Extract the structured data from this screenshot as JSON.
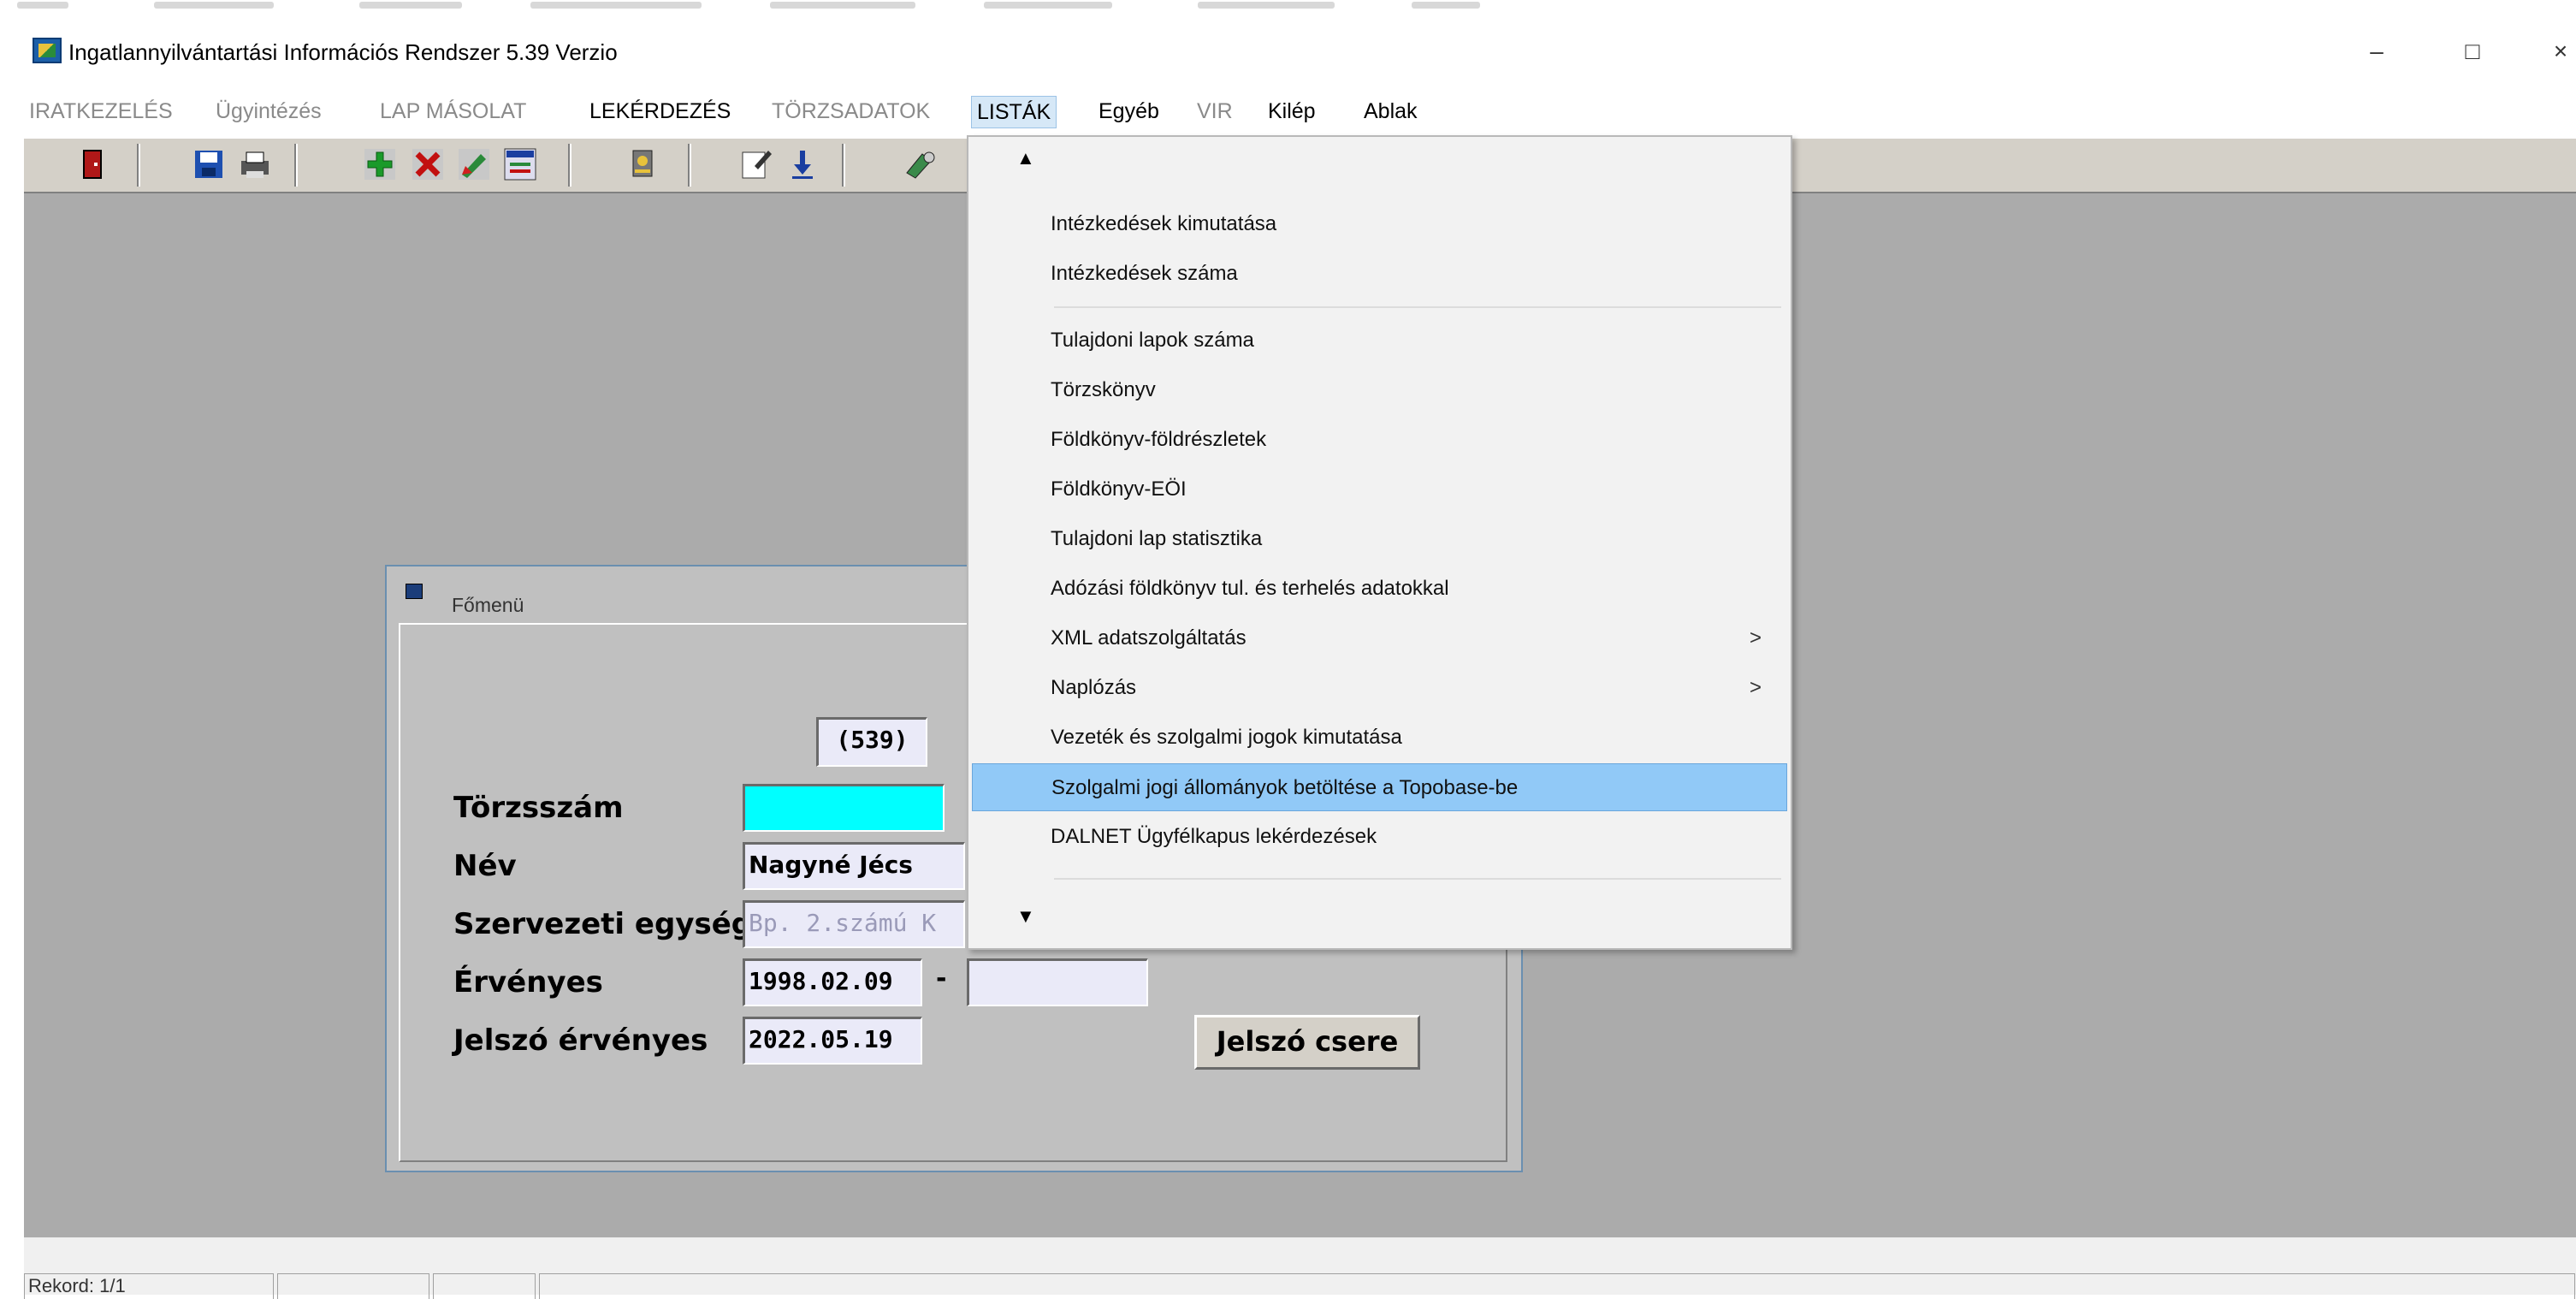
{
  "window": {
    "title": "Ingatlannyilvántartási Információs Rendszer 5.39 Verzio",
    "minimize": "–",
    "maximize": "□",
    "close": "×"
  },
  "menubar": [
    {
      "label": "IRATKEZELÉS",
      "state": "dim"
    },
    {
      "label": "Ügyintézés",
      "state": "dim"
    },
    {
      "label": "LAP MÁSOLAT",
      "state": "dim"
    },
    {
      "label": "LEKÉRDEZÉS",
      "state": "normal"
    },
    {
      "label": "TÖRZSADATOK",
      "state": "dim"
    },
    {
      "label": "LISTÁK",
      "state": "active"
    },
    {
      "label": "Egyéb",
      "state": "normal"
    },
    {
      "label": "VIR",
      "state": "dim"
    },
    {
      "label": "Kilép",
      "state": "normal"
    },
    {
      "label": "Ablak",
      "state": "normal"
    }
  ],
  "toolbar": {
    "icons": [
      "exit-door-icon",
      "save-icon",
      "print-icon",
      "add-record-icon",
      "delete-record-icon",
      "edit-record-icon",
      "form-icon",
      "key-icon",
      "notes-icon",
      "download-icon",
      "tool-icon"
    ]
  },
  "listak_menu": {
    "scroll_up": "▲",
    "scroll_down": "▼",
    "groups": [
      [
        "Intézkedések kimutatása",
        "Intézkedések száma"
      ],
      [
        "Tulajdoni lapok száma",
        "Törzskönyv",
        "Földkönyv-földrészletek",
        "Földkönyv-EÖI",
        "Tulajdoni lap statisztika",
        "Adózási földkönyv tul. és terhelés adatokkal",
        "XML adatszolgáltatás",
        "Naplózás",
        "Vezeték és szolgalmi jogok kimutatása",
        "Szolgalmi jogi állományok betöltése a Topobase-be",
        "DALNET Ügyfélkapus lekérdezések"
      ]
    ],
    "submenu_arrow": ">",
    "highlighted": "Szolgalmi jogi állományok betöltése a Topobase-be"
  },
  "main_window": {
    "title": "Főmenü",
    "version_badge": "(539)",
    "fields": {
      "torzsszam": {
        "label": "Törzsszám",
        "value": ""
      },
      "nev": {
        "label": "Név",
        "value": "Nagyné Jécs"
      },
      "szervezeti_egyseg": {
        "label": "Szervezeti egység",
        "value": "Bp. 2.számú K"
      },
      "ervenyes": {
        "label": "Érvényes",
        "from": "1998.02.09",
        "dash": "-",
        "to": ""
      },
      "jelszo_ervenyes": {
        "label": "Jelszó érvényes",
        "value": "2022.05.19"
      }
    },
    "password_change_button": "Jelszó csere"
  },
  "statusbar": {
    "record": "Rekord: 1/1"
  },
  "colors": {
    "workspace": "#ababab",
    "highlight": "#91c9f7",
    "cyan_field": "#00ffff"
  }
}
